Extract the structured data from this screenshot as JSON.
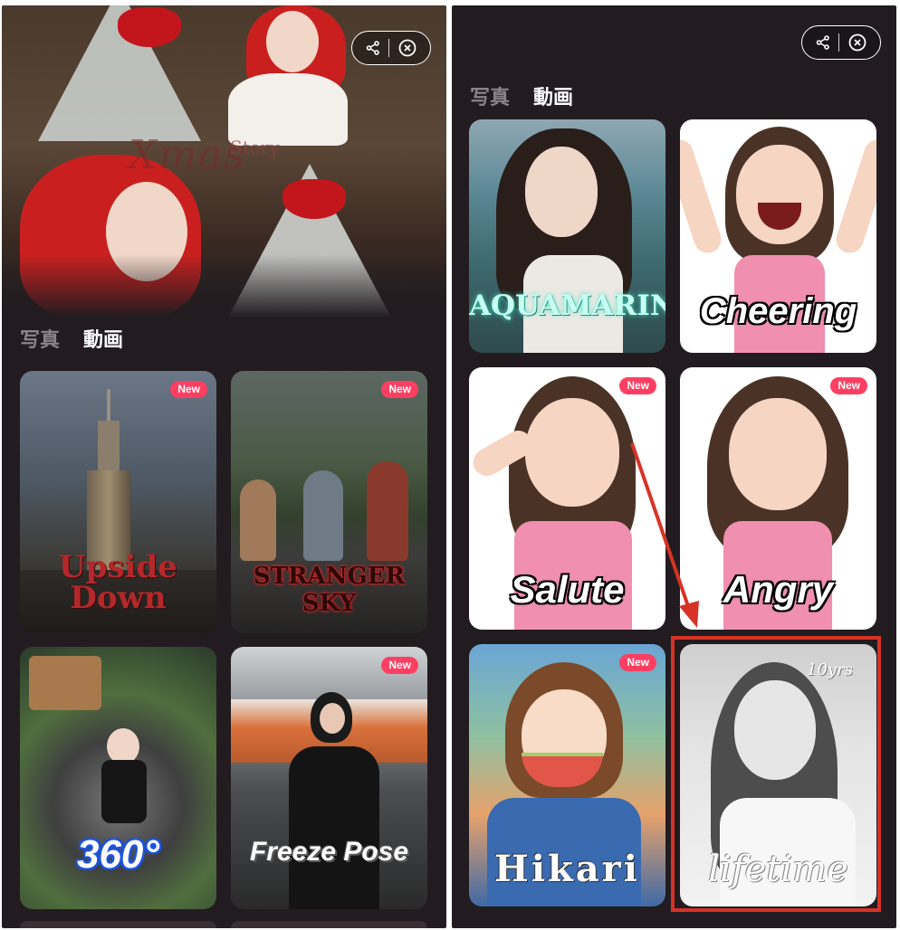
{
  "left_panel": {
    "banner": {
      "title": "Xmas",
      "subtitle": "Story"
    },
    "tabs": [
      {
        "label": "写真"
      },
      {
        "label": "動画"
      }
    ],
    "cards": [
      {
        "label": "Upside Down",
        "badge": "New"
      },
      {
        "label": "STRANGER SKY",
        "badge": "New"
      },
      {
        "label": "360°",
        "badge": ""
      },
      {
        "label": "Freeze Pose",
        "badge": "New"
      }
    ]
  },
  "right_panel": {
    "tabs": [
      {
        "label": "写真"
      },
      {
        "label": "動画"
      }
    ],
    "cards": [
      {
        "label": "AQUAMARINE",
        "badge": ""
      },
      {
        "label": "Cheering",
        "badge": ""
      },
      {
        "label": "Salute",
        "badge": "New"
      },
      {
        "label": "Angry",
        "badge": "New"
      },
      {
        "label": "Hikari",
        "badge": "New"
      },
      {
        "label": "lifetime",
        "badge": "",
        "corner_text": "10yrs"
      }
    ]
  },
  "icons": {
    "share": "share-icon",
    "close": "close-circle-icon"
  },
  "colors": {
    "panel_bg": "#221c20",
    "badge": "#ff3f62",
    "highlight": "#d63326",
    "arrow": "#d63326"
  }
}
